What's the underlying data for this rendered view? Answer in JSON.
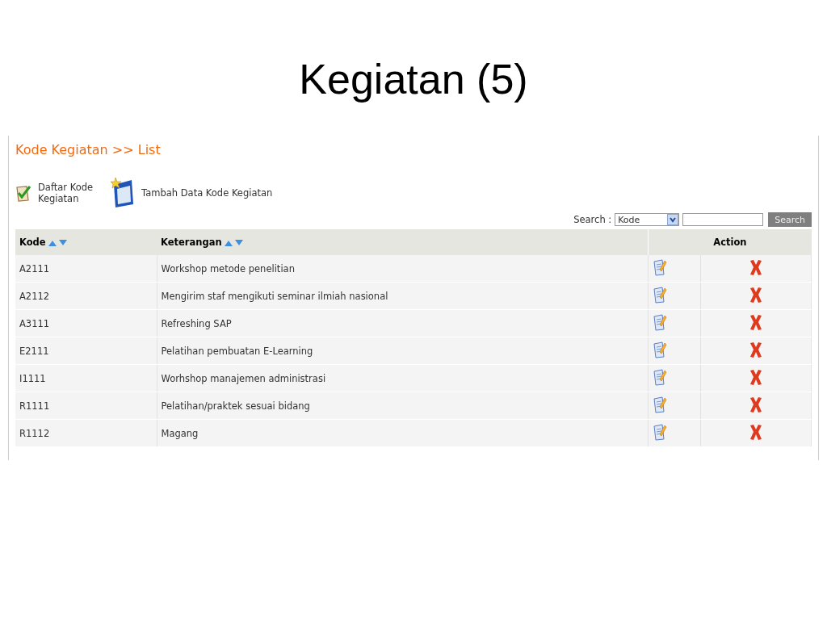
{
  "slide_title": "Kegiatan (5)",
  "page": {
    "breadcrumb": "Kode Kegiatan >> List",
    "toolbar": [
      {
        "kind": "list",
        "label": "Daftar Kode\nKegiatan"
      },
      {
        "kind": "add",
        "label": "Tambah Data Kode Kegiatan"
      }
    ],
    "search": {
      "label": "Search :",
      "field": "Kode",
      "button": "Search"
    },
    "table": {
      "columns": [
        "Kode",
        "Keterangan",
        "Action"
      ],
      "rows": [
        {
          "kode": "A2111",
          "keterangan": "Workshop metode penelitian"
        },
        {
          "kode": "A2112",
          "keterangan": "Mengirim staf mengikuti seminar ilmiah nasional"
        },
        {
          "kode": "A3111",
          "keterangan": "Refreshing SAP"
        },
        {
          "kode": "E2111",
          "keterangan": "Pelatihan pembuatan E-Learning"
        },
        {
          "kode": "I1111",
          "keterangan": "Worhshop manajemen administrasi"
        },
        {
          "kode": "R1111",
          "keterangan": "Pelatihan/praktek sesuai bidang"
        },
        {
          "kode": "R1112",
          "keterangan": "Magang"
        }
      ]
    }
  }
}
